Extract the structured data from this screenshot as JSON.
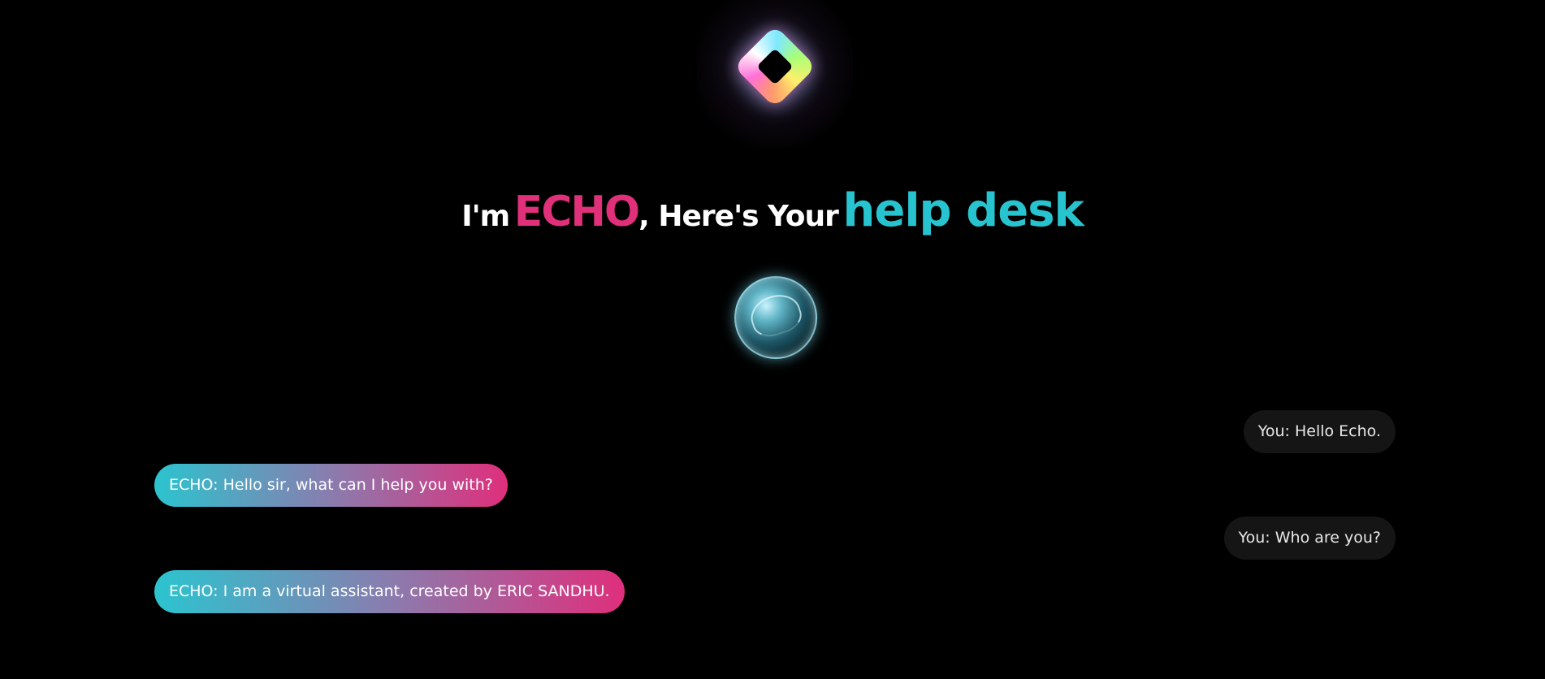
{
  "app": {
    "logo_icon": "rainbow-diamond-logo-icon",
    "orb_icon": "glowing-orb-icon"
  },
  "headline": {
    "part1": "I'm",
    "name": "ECHO",
    "part2": ", Here's Your",
    "highlight": "help desk",
    "colors": {
      "name": "#e0307a",
      "highlight": "#27c4d0",
      "text": "#ffffff"
    }
  },
  "chat": {
    "messages": [
      {
        "role": "user",
        "text": "You: Hello Echo."
      },
      {
        "role": "bot",
        "text": "ECHO: Hello sir, what can I help you with?"
      },
      {
        "role": "user",
        "text": "You: Who are you?"
      },
      {
        "role": "bot",
        "text": "ECHO: I am a virtual assistant, created by ERIC SANDHU."
      }
    ],
    "colors": {
      "user_bubble": "#151515",
      "bot_gradient_start": "#2bc4cf",
      "bot_gradient_end": "#df2f7c"
    }
  }
}
